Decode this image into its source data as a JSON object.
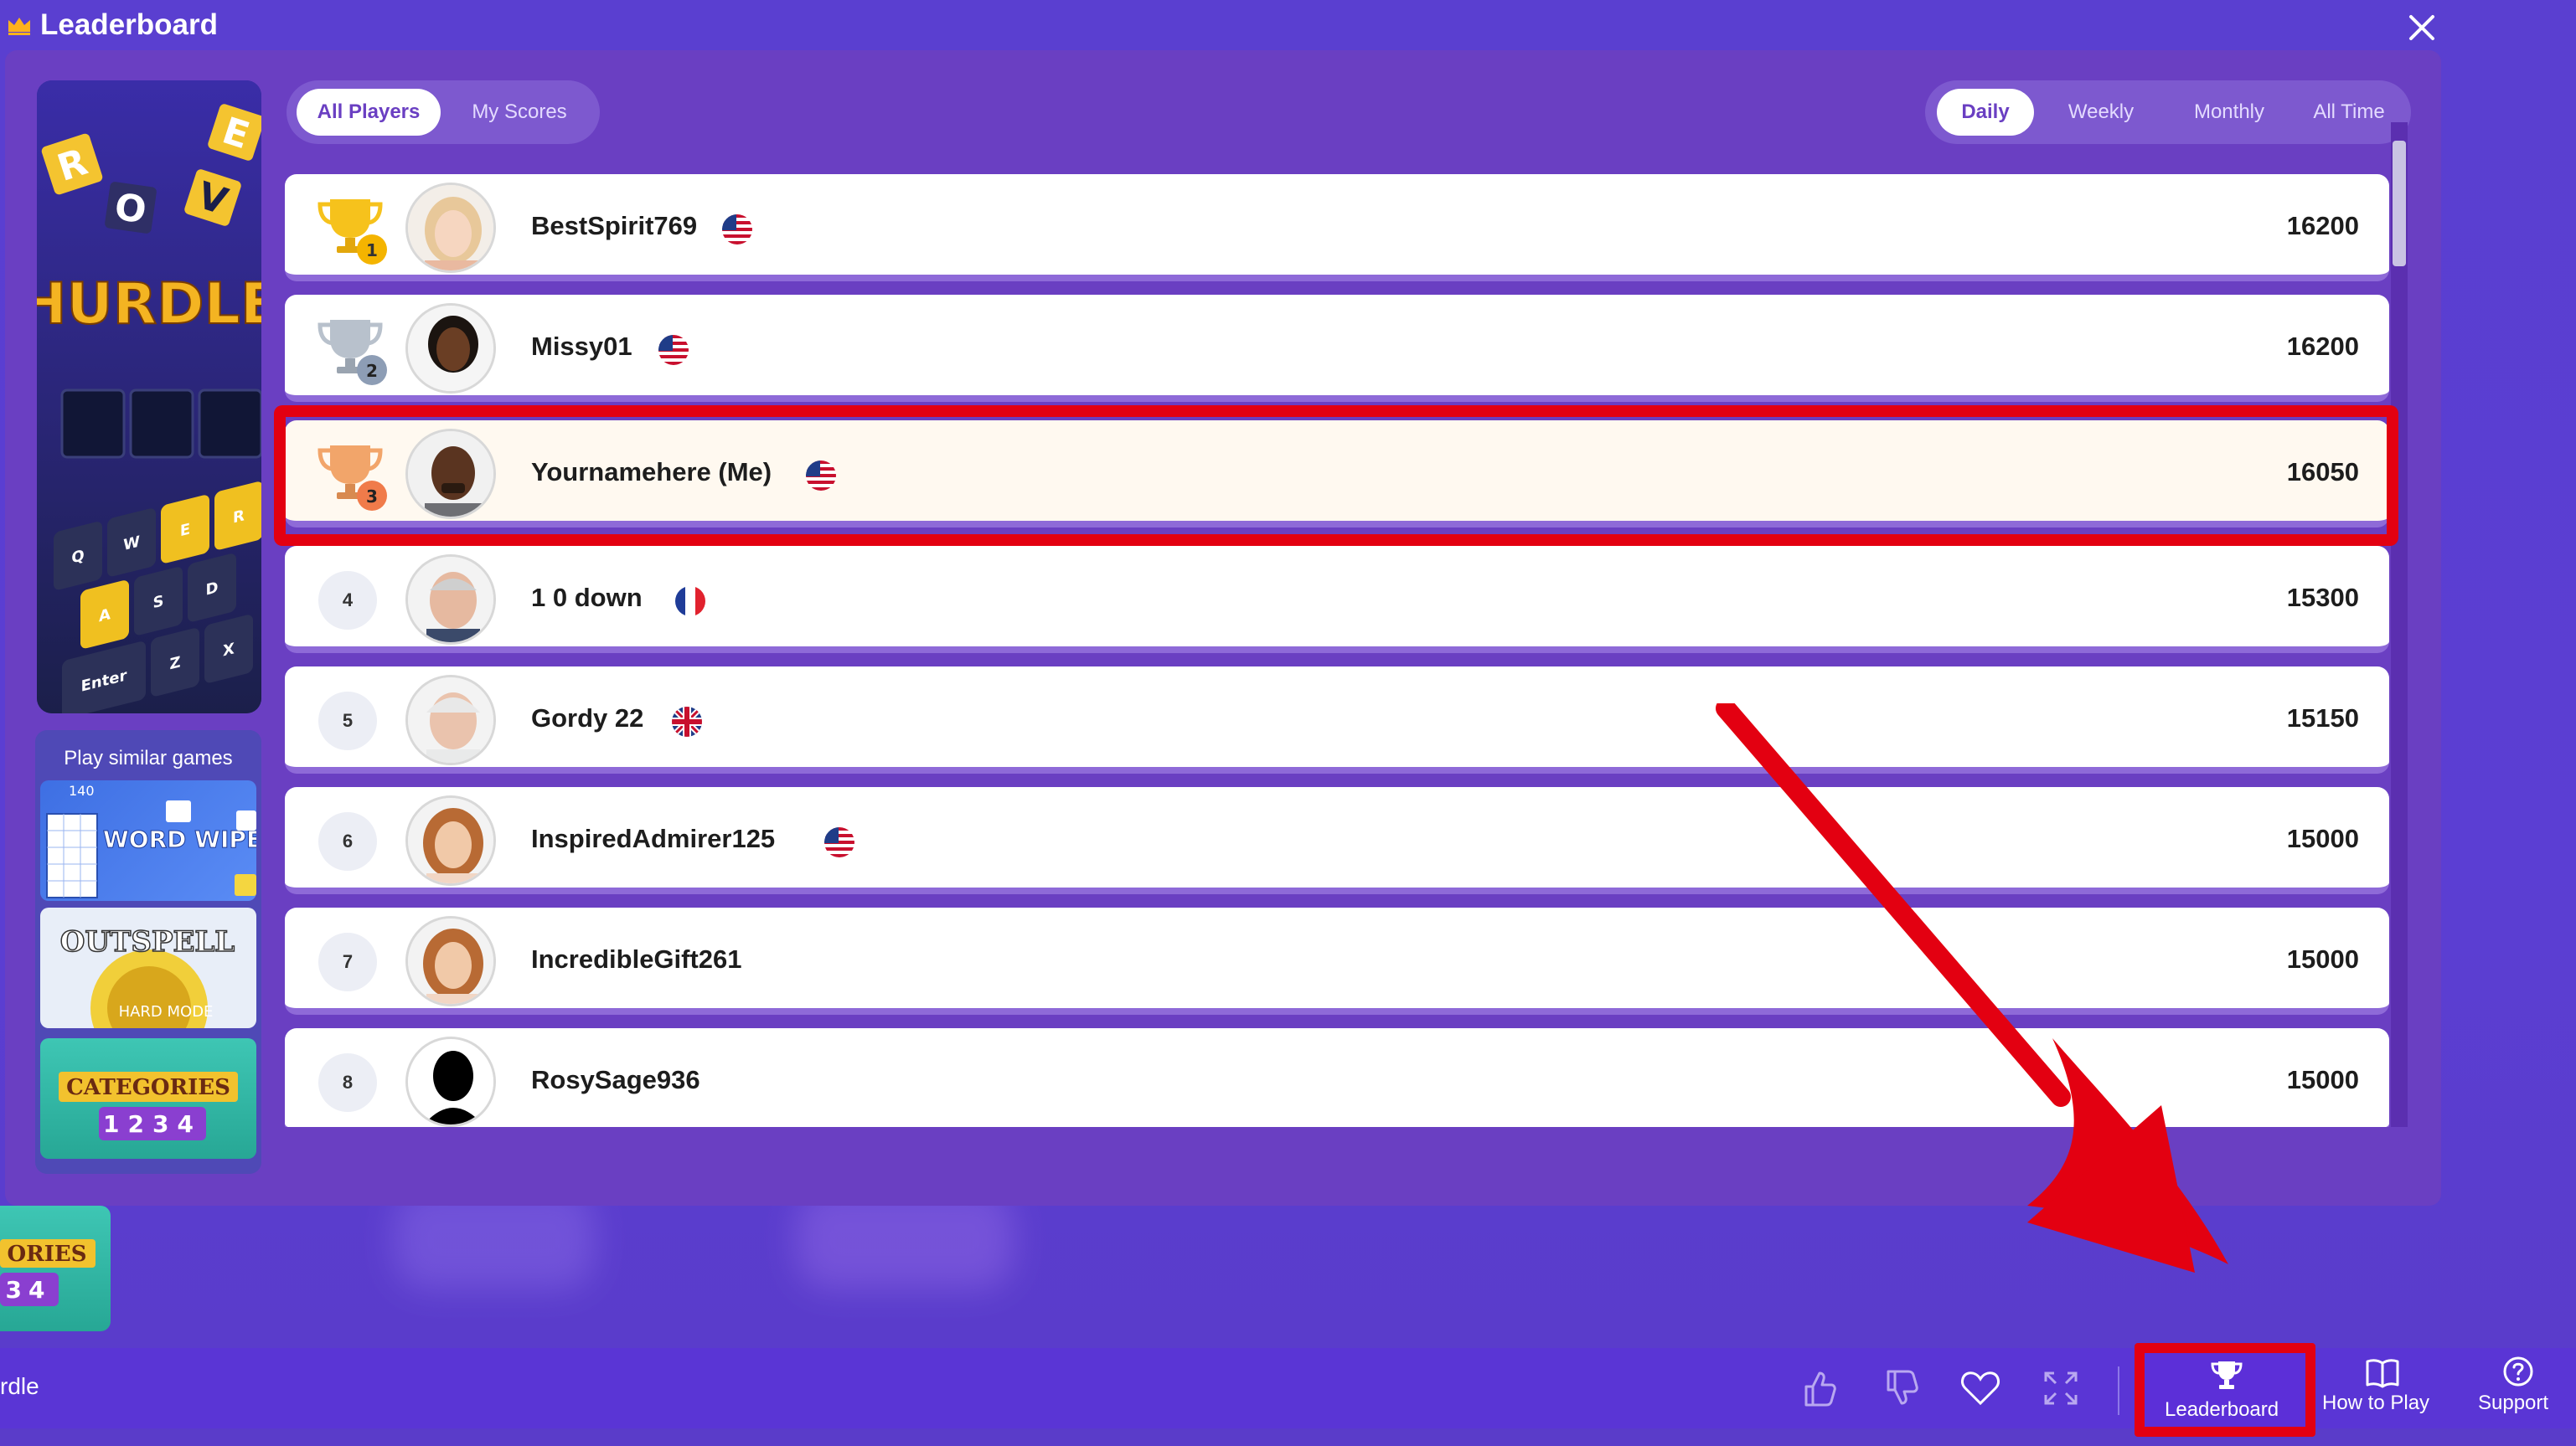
{
  "app": {
    "title": "Leaderboard",
    "partial_game_name": "rdle"
  },
  "promo": {
    "letters": [
      "R",
      "O",
      "V",
      "E"
    ],
    "game_title": "HURDLE",
    "keys": [
      "Q",
      "W",
      "E",
      "R",
      "A",
      "S",
      "D",
      "Enter",
      "Z",
      "X"
    ]
  },
  "similar": {
    "title": "Play similar games",
    "games": [
      {
        "name": "WORD WIPE",
        "badge": "140"
      },
      {
        "name": "OUTSPELL",
        "badge": "HARD MODE"
      },
      {
        "name": "CATEGORIES",
        "badge": "1234"
      }
    ],
    "peek_label_1": "ORIES",
    "peek_label_2": "34"
  },
  "player_tabs": [
    {
      "label": "All Players",
      "active": true
    },
    {
      "label": "My Scores",
      "active": false
    }
  ],
  "period_tabs": [
    {
      "label": "Daily",
      "active": true
    },
    {
      "label": "Weekly",
      "active": false
    },
    {
      "label": "Monthly",
      "active": false
    },
    {
      "label": "All Time",
      "active": false
    }
  ],
  "leaderboard": [
    {
      "rank": "1",
      "name": "BestSpirit769",
      "flag": "us",
      "score": "16200",
      "trophy": "gold"
    },
    {
      "rank": "2",
      "name": "Missy01",
      "flag": "us",
      "score": "16200",
      "trophy": "silver"
    },
    {
      "rank": "3",
      "name": "Yournamehere (Me)",
      "flag": "us",
      "score": "16050",
      "trophy": "bronze",
      "is_me": true
    },
    {
      "rank": "4",
      "name": "1 0 down",
      "flag": "fr",
      "score": "15300"
    },
    {
      "rank": "5",
      "name": "Gordy 22",
      "flag": "gb",
      "score": "15150"
    },
    {
      "rank": "6",
      "name": "InspiredAdmirer125",
      "flag": "us",
      "score": "15000"
    },
    {
      "rank": "7",
      "name": "IncredibleGift261",
      "flag": "",
      "score": "15000"
    },
    {
      "rank": "8",
      "name": "RosySage936",
      "flag": "",
      "score": "15000"
    }
  ],
  "bottom_toolbar": {
    "leaderboard_label": "Leaderboard",
    "how_to_play_label": "How to Play",
    "support_label": "Support"
  },
  "colors": {
    "accent": "#6a3fc2",
    "highlight": "#e30011",
    "background": "#5a3fd0"
  }
}
